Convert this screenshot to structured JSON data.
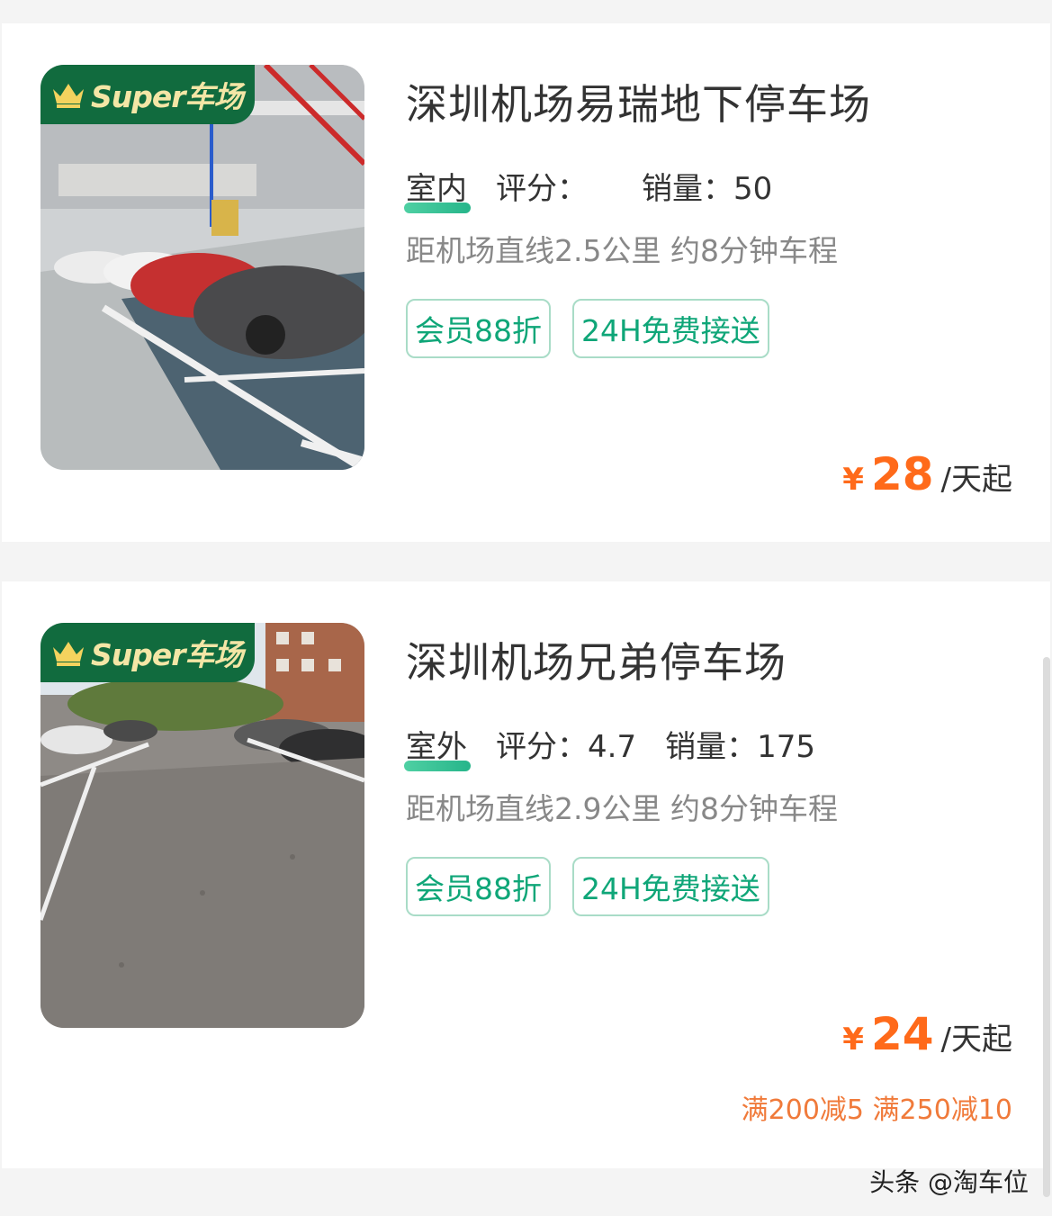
{
  "badge_text": "Super车场",
  "tag_color": "#0fa678",
  "price_color": "#ff6a1a",
  "cards": [
    {
      "name": "深圳机场易瑞地下停车场",
      "env": "室内",
      "rating_label": "评分：",
      "rating": "",
      "sales_label": "销量：",
      "sales": "50",
      "distance": "距机场直线2.5公里 约8分钟车程",
      "tags": [
        "会员88折",
        "24H免费接送"
      ],
      "currency": "¥",
      "price": "28",
      "unit": "/天起",
      "promo": ""
    },
    {
      "name": "深圳机场兄弟停车场",
      "env": "室外",
      "rating_label": "评分：",
      "rating": "4.7",
      "sales_label": "销量：",
      "sales": "175",
      "distance": "距机场直线2.9公里 约8分钟车程",
      "tags": [
        "会员88折",
        "24H免费接送"
      ],
      "currency": "¥",
      "price": "24",
      "unit": "/天起",
      "promo": "满200减5 满250减10"
    }
  ],
  "watermark": "头条 @淘车位"
}
